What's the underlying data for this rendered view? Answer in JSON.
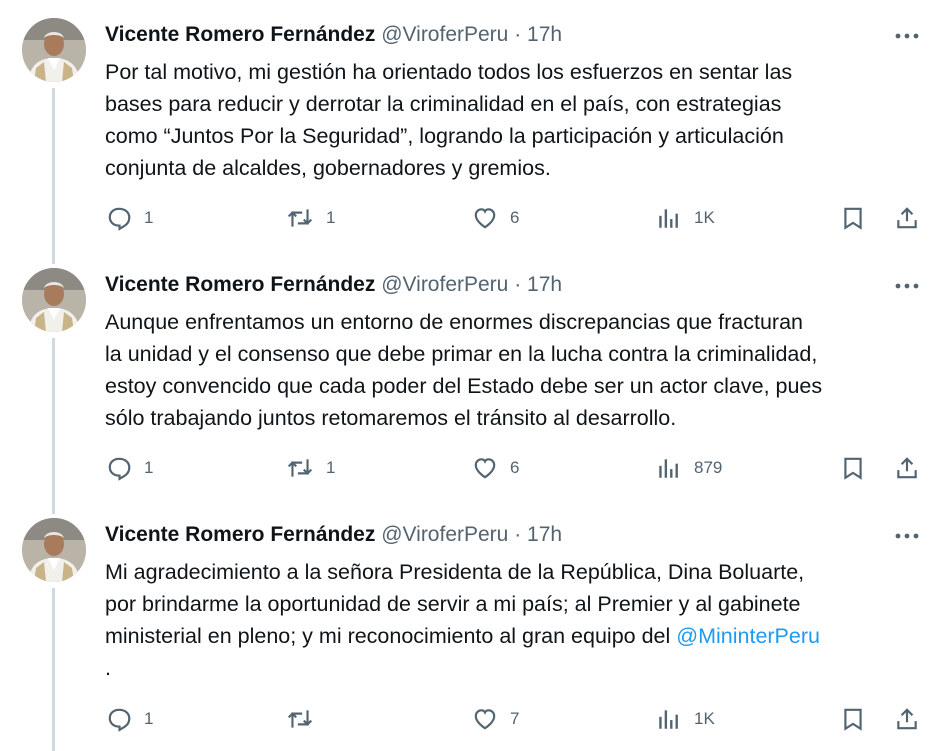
{
  "tweets": [
    {
      "author_name": "Vicente Romero Fernández",
      "handle": "@ViroferPeru",
      "separator": "·",
      "time": "17h",
      "lines": [
        "Por tal motivo, mi gestión ha orientado todos los esfuerzos en sentar las",
        "bases para reducir y derrotar la criminalidad en el país, con estrategias",
        "como “Juntos Por la Seguridad”, logrando la participación y articulación",
        "conjunta de alcaldes, gobernadores y gremios."
      ],
      "replies": "1",
      "reposts": "1",
      "likes": "6",
      "views": "1K"
    },
    {
      "author_name": "Vicente Romero Fernández",
      "handle": "@ViroferPeru",
      "separator": "·",
      "time": "17h",
      "lines": [
        "Aunque enfrentamos un entorno de enormes discrepancias que fracturan",
        "la unidad y el consenso que debe primar en la lucha contra la criminalidad,",
        "estoy convencido que cada poder del Estado debe ser un actor clave, pues",
        "sólo trabajando juntos retomaremos el tránsito al desarrollo."
      ],
      "replies": "1",
      "reposts": "1",
      "likes": "6",
      "views": "879"
    },
    {
      "author_name": "Vicente Romero Fernández",
      "handle": "@ViroferPeru",
      "separator": "·",
      "time": "17h",
      "lines": [
        "Mi agradecimiento a la señora Presidenta de la República, Dina Boluarte,",
        "por brindarme la oportunidad de servir a mi país; al Premier y al gabinete",
        "ministerial en pleno; y mi reconocimiento al gran equipo del "
      ],
      "mention": "@MininterPeru",
      "last_line": ".",
      "replies": "1",
      "reposts": "",
      "likes": "7",
      "views": "1K"
    }
  ],
  "icons": {
    "more": "more-icon",
    "reply": "reply-icon",
    "repost": "repost-icon",
    "like": "like-icon",
    "views": "views-icon",
    "bookmark": "bookmark-icon",
    "share": "share-icon"
  },
  "colors": {
    "text": "#0f1419",
    "secondary": "#536471",
    "mention": "#1d9bf0",
    "thread_line": "#cfd9de"
  }
}
